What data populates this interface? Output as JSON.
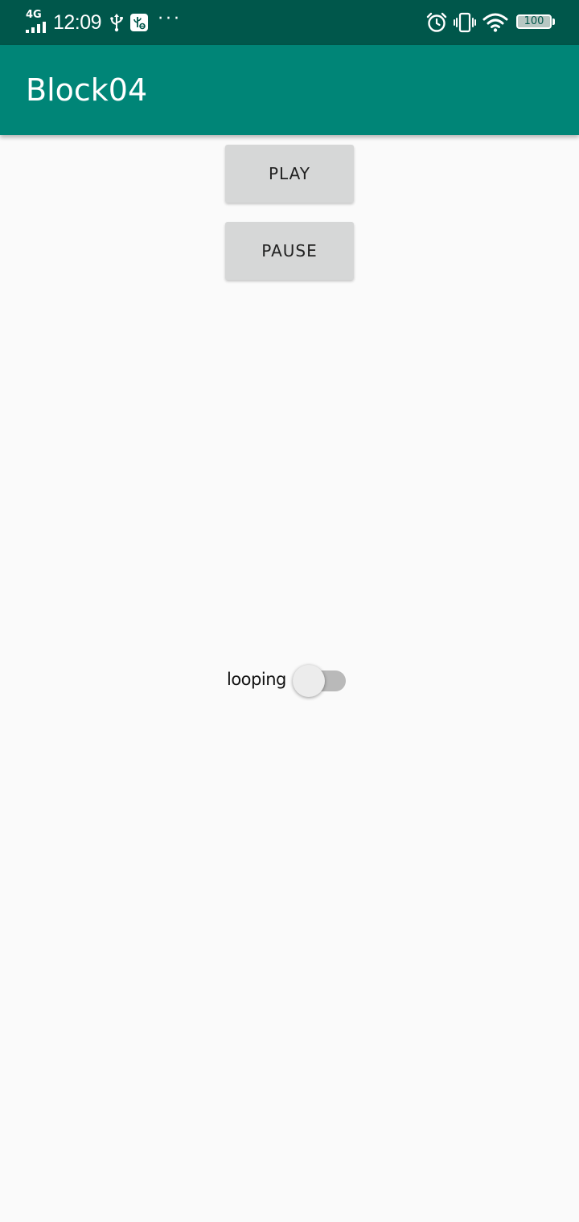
{
  "status_bar": {
    "network": "4G",
    "time": "12:09",
    "overflow": "···",
    "battery_level": "100",
    "icons": {
      "signal": "signal-icon",
      "usb": "usb-icon",
      "usb_debug": "usb-debugging-icon",
      "alarm": "alarm-icon",
      "vibrate": "vibrate-icon",
      "wifi": "wifi-icon",
      "battery": "battery-icon"
    }
  },
  "app_bar": {
    "title": "Block04"
  },
  "buttons": {
    "play": "PLAY",
    "pause": "PAUSE"
  },
  "looping": {
    "label": "looping",
    "checked": false
  },
  "colors": {
    "status_bar": "#00574b",
    "app_bar": "#008577",
    "background": "#fafafa",
    "button": "#d6d7d7",
    "switch_track": "#b9b9b9",
    "switch_thumb": "#ececec"
  }
}
